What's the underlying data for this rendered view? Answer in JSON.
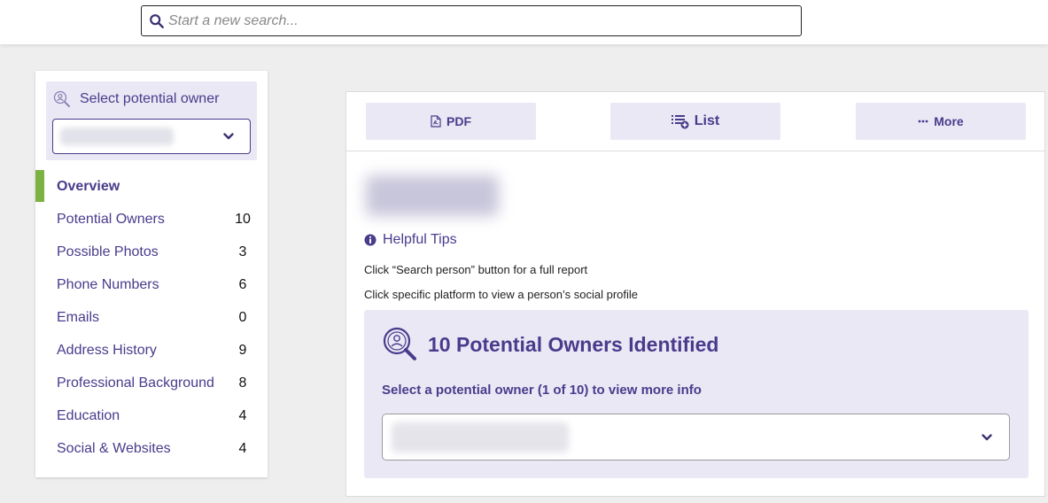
{
  "search": {
    "placeholder": "Start a new search..."
  },
  "sidebar": {
    "select_title": "Select potential owner",
    "items": [
      {
        "label": "Overview",
        "count": ""
      },
      {
        "label": "Potential Owners",
        "count": "10"
      },
      {
        "label": "Possible Photos",
        "count": "3"
      },
      {
        "label": "Phone Numbers",
        "count": "6"
      },
      {
        "label": "Emails",
        "count": "0"
      },
      {
        "label": "Address History",
        "count": "9"
      },
      {
        "label": "Professional Background",
        "count": "8"
      },
      {
        "label": "Education",
        "count": "4"
      },
      {
        "label": "Social & Websites",
        "count": "4"
      }
    ]
  },
  "toolbar": {
    "pdf_label": "PDF",
    "list_label": "List",
    "more_label": "More"
  },
  "tips": {
    "title": "Helpful Tips",
    "line1": "Click “Search person” button for a full report",
    "line2": "Click specific platform to view a person’s social profile"
  },
  "owners": {
    "heading": "10 Potential Owners Identified",
    "subtitle": "Select a potential owner (1 of 10) to view more info"
  },
  "colors": {
    "accent": "#4a3b8c",
    "active_indicator": "#7bb241",
    "panel_tint": "#eae8f5"
  },
  "icons": [
    "search-icon",
    "person-search-icon",
    "chevron-down-icon",
    "pdf-icon",
    "list-add-icon",
    "more-dots-icon",
    "info-icon"
  ]
}
